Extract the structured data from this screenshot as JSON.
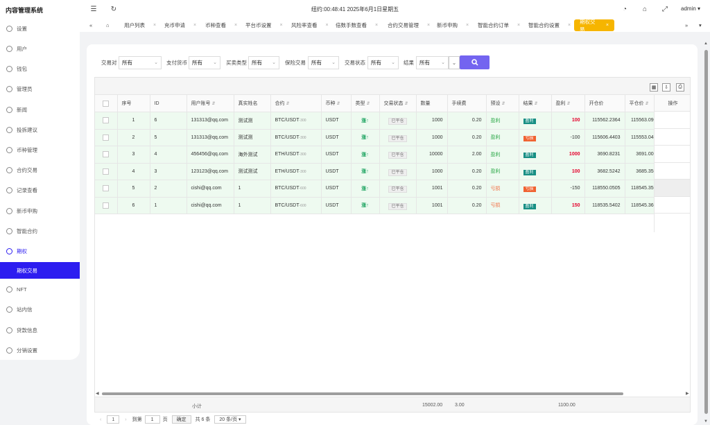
{
  "app": {
    "title": "内容管理系统",
    "clock": "纽约:00:48:41 2025年6月1日星期五",
    "user": "admin"
  },
  "topbar_icons": [
    "menu-fold-icon",
    "refresh-icon",
    "theme-icon",
    "tag-icon",
    "fullscreen-icon"
  ],
  "sidebar": {
    "items": [
      {
        "label": "设置",
        "icon": "gear-icon"
      },
      {
        "label": "用户",
        "icon": "user-icon"
      },
      {
        "label": "钱包",
        "icon": "wallet-icon"
      },
      {
        "label": "管理员",
        "icon": "shield-icon"
      },
      {
        "label": "新闻",
        "icon": "tag-icon"
      },
      {
        "label": "投拆建议",
        "icon": "flag-icon"
      },
      {
        "label": "币种管理",
        "icon": "diamond-icon"
      },
      {
        "label": "合约交易",
        "icon": "diamond-icon"
      },
      {
        "label": "记录查看",
        "icon": "record-icon"
      },
      {
        "label": "新币申购",
        "icon": "coin-icon"
      },
      {
        "label": "智能合约",
        "icon": "contract-icon"
      },
      {
        "label": "期权",
        "icon": "option-icon"
      },
      {
        "label": "期权交易",
        "icon": ""
      },
      {
        "label": "NFT",
        "icon": "nft-icon"
      },
      {
        "label": "站内信",
        "icon": "bell-icon"
      },
      {
        "label": "贷款信息",
        "icon": "loan-icon"
      },
      {
        "label": "分销设置",
        "icon": "gear-icon"
      }
    ]
  },
  "tabs": [
    "用户列表",
    "充币申请",
    "币种查看",
    "平台币设置",
    "风险率查看",
    "倍数手数查看",
    "合约交易管理",
    "新币申购",
    "智能合约订单",
    "智能合约设置",
    "期权交易"
  ],
  "filters": [
    {
      "label": "交易对",
      "value": "所有"
    },
    {
      "label": "支付货币",
      "value": "所有"
    },
    {
      "label": "买卖类型",
      "value": "所有"
    },
    {
      "label": "保险交易",
      "value": "所有"
    },
    {
      "label": "交易状态",
      "value": "所有"
    },
    {
      "label": "结果",
      "value": "所有"
    }
  ],
  "columns": [
    "序号",
    "ID",
    "用户账号",
    "真实姓名",
    "合约",
    "币种",
    "类型",
    "交易状态",
    "数量",
    "手续费",
    "预设",
    "结果",
    "盈利",
    "开仓价",
    "平仓价",
    "操作"
  ],
  "rows": [
    {
      "no": "1",
      "id": "6",
      "account": "131313@qq.com",
      "name": "测试测",
      "pair": "BTC/USDT",
      "pair_suffix": "-300",
      "currency": "USDT",
      "type": "涨↑",
      "status": "已平仓",
      "qty": "1000",
      "fee": "0.20",
      "preset": "盈利",
      "result": "盈利",
      "profit": "100",
      "open": "115562.2364",
      "close": "115563.090"
    },
    {
      "no": "2",
      "id": "5",
      "account": "131313@qq.com",
      "name": "测试测",
      "pair": "BTC/USDT",
      "pair_suffix": "-300",
      "currency": "USDT",
      "type": "涨↑",
      "status": "已平仓",
      "qty": "1000",
      "fee": "0.20",
      "preset": "盈利",
      "result": "亏损",
      "profit": "-100",
      "open": "115606.4403",
      "close": "115553.040"
    },
    {
      "no": "3",
      "id": "4",
      "account": "456456@qq.com",
      "name": "海外测试",
      "pair": "ETH/USDT",
      "pair_suffix": "-300",
      "currency": "USDT",
      "type": "涨↑",
      "status": "已平仓",
      "qty": "10000",
      "fee": "2.00",
      "preset": "盈利",
      "result": "盈利",
      "profit": "1000",
      "open": "3690.8231",
      "close": "3691.000"
    },
    {
      "no": "4",
      "id": "3",
      "account": "123123@qq.com",
      "name": "测试测试",
      "pair": "ETH/USDT",
      "pair_suffix": "-300",
      "currency": "USDT",
      "type": "涨↑",
      "status": "已平仓",
      "qty": "1000",
      "fee": "0.20",
      "preset": "盈利",
      "result": "盈利",
      "profit": "100",
      "open": "3682.5242",
      "close": "3685.350"
    },
    {
      "no": "5",
      "id": "2",
      "account": "cishi@qq.com",
      "name": "1",
      "pair": "BTC/USDT",
      "pair_suffix": "-600",
      "currency": "USDT",
      "type": "涨↑",
      "status": "已平仓",
      "qty": "1001",
      "fee": "0.20",
      "preset": "亏损",
      "result": "亏损",
      "profit": "-150",
      "open": "118550.0505",
      "close": "118545.350"
    },
    {
      "no": "6",
      "id": "1",
      "account": "cishi@qq.com",
      "name": "1",
      "pair": "BTC/USDT",
      "pair_suffix": "-600",
      "currency": "USDT",
      "type": "涨↑",
      "status": "已平仓",
      "qty": "1001",
      "fee": "0.20",
      "preset": "亏损",
      "result": "盈利",
      "profit": "150",
      "open": "118535.5402",
      "close": "118545.360"
    }
  ],
  "summary": {
    "label": "小计",
    "qty": "15002.00",
    "fee": "3.00",
    "profit": "1100.00"
  },
  "pager": {
    "current": "1",
    "goto_prefix": "到第",
    "goto_value": "1",
    "goto_suffix": "页",
    "confirm": "确定",
    "total": "共 6 条",
    "page_size": "20 条/页"
  },
  "colors": {
    "accent": "#2d1df0",
    "active_tab": "#f6b500",
    "search": "#7364f0",
    "win": "#178f84",
    "loss": "#f06332"
  }
}
